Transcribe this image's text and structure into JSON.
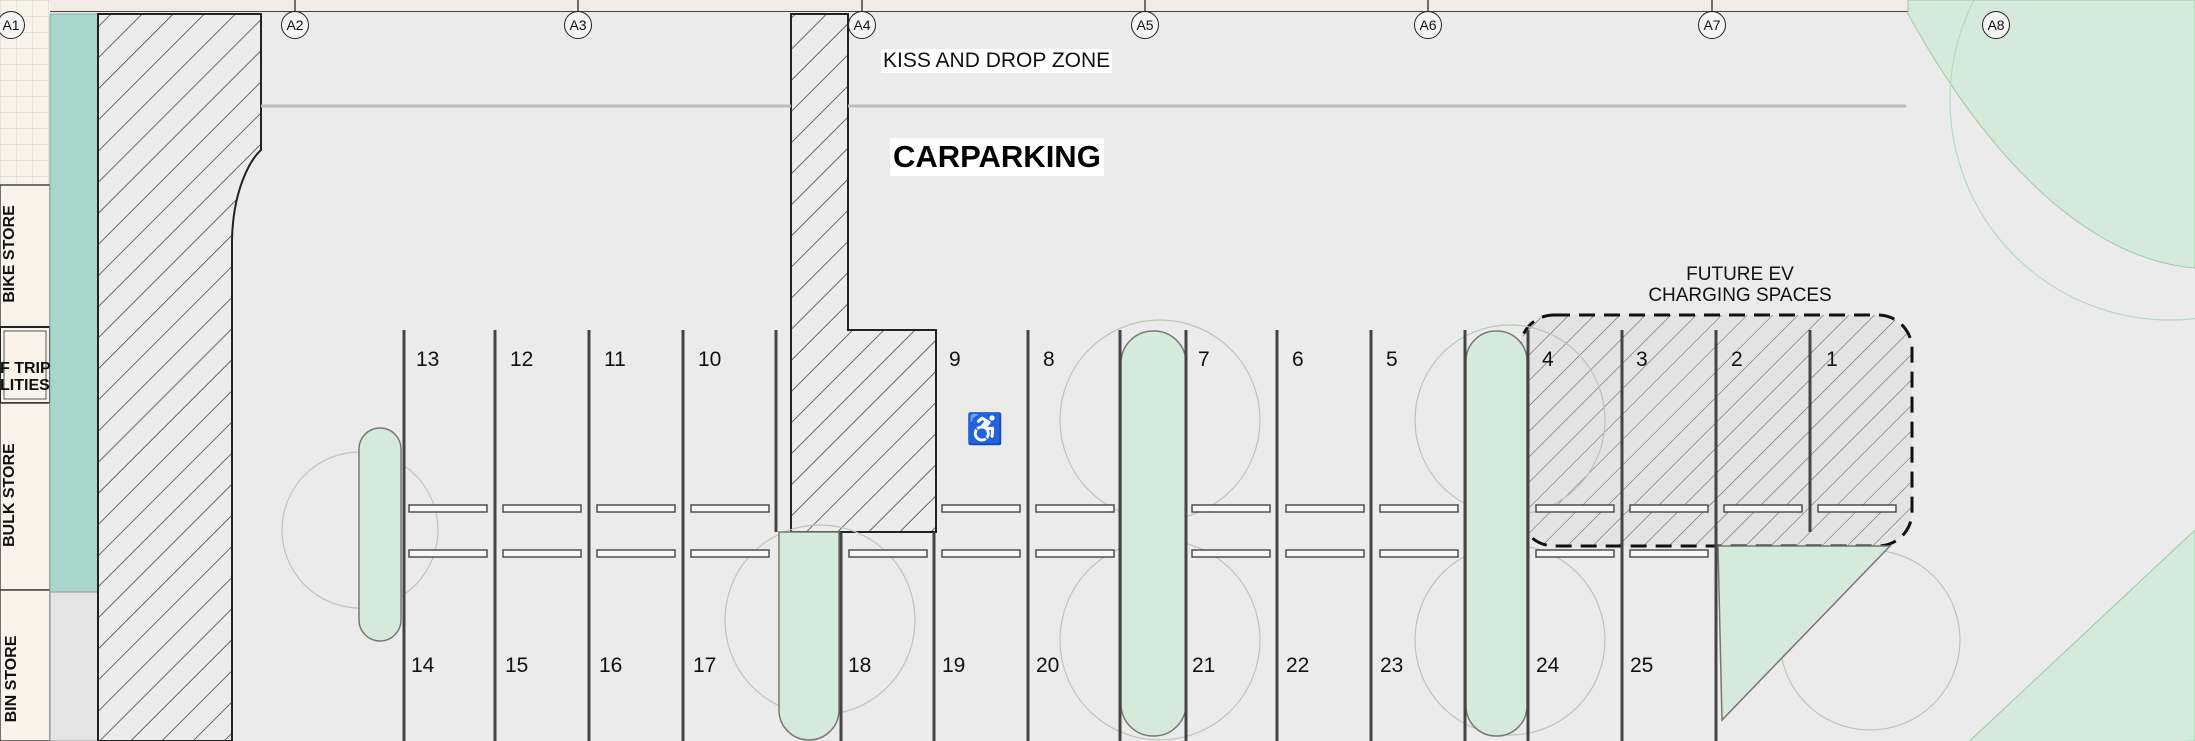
{
  "plan": {
    "title": "CARPARKING",
    "drop_zone_label": "KISS AND DROP ZONE",
    "ev_label_line1": "FUTURE EV",
    "ev_label_line2": "CHARGING SPACES",
    "accessible_icon": "wheelchair-icon"
  },
  "grid_lines": [
    "A1",
    "A2",
    "A3",
    "A4",
    "A5",
    "A6",
    "A7",
    "A8"
  ],
  "rooms": {
    "bike_store": "BIKE STORE",
    "eot_line1": "F TRIP",
    "eot_line2": "LITIES",
    "bulk_store": "BULK STORE",
    "bin_store": "BIN STORE"
  },
  "bays_top": [
    "13",
    "12",
    "11",
    "10",
    "9",
    "8",
    "7",
    "6",
    "5",
    "4",
    "3",
    "2",
    "1"
  ],
  "bays_bottom": [
    "14",
    "15",
    "16",
    "17",
    "18",
    "19",
    "20",
    "21",
    "22",
    "23",
    "24",
    "25"
  ],
  "colors": {
    "paving": "#ebebeb",
    "landscape": "#d5eadb",
    "teal_strip": "#a8d5cc",
    "hatch": "#333333",
    "building": "#fbf3ea"
  }
}
